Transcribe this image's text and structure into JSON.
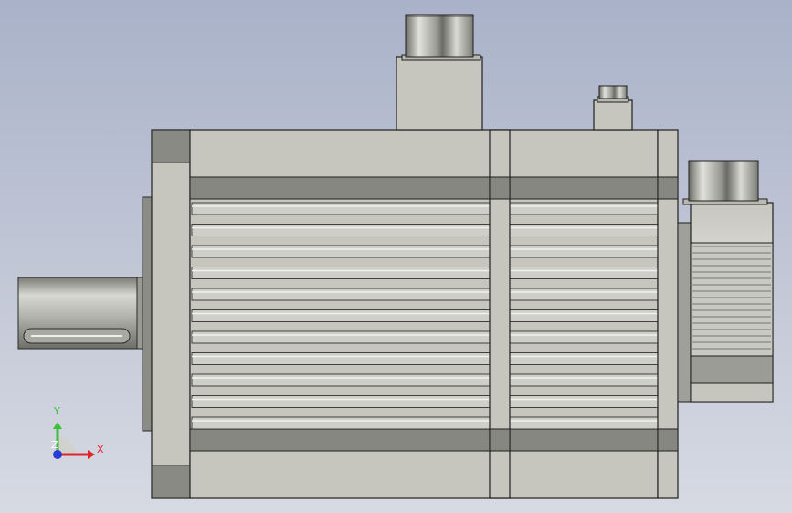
{
  "viewport": {
    "background_top": "#a9b2c9",
    "background_bottom": "#d7dae3",
    "part_color": "#c6c6bf",
    "edge_color": "#1f1f1f"
  },
  "triad": {
    "x_label": "X",
    "y_label": "Y",
    "z_label": "Z",
    "x_color": "#e0262a",
    "y_color": "#3cbf3a",
    "z_color": "#2a3bd6"
  }
}
